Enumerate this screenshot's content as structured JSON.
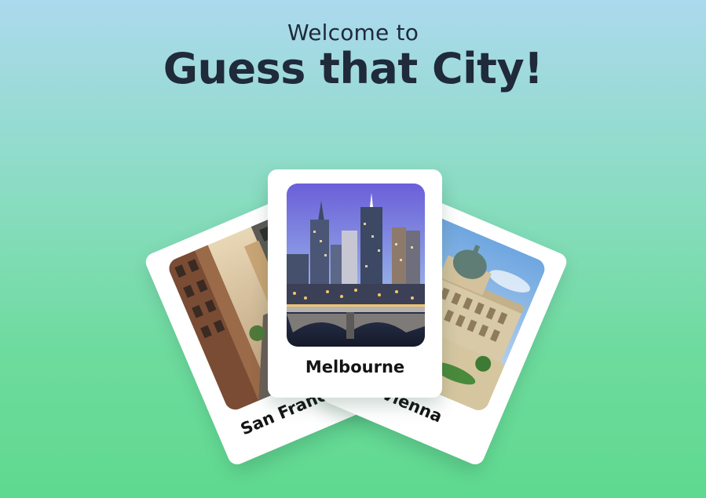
{
  "header": {
    "welcome": "Welcome to",
    "title": "Guess that City!"
  },
  "cards": [
    {
      "city": "San Francisco",
      "photo": "san-francisco-cable-car-street-photo"
    },
    {
      "city": "Vienna",
      "photo": "vienna-museum-palace-photo"
    },
    {
      "city": "Melbourne",
      "photo": "melbourne-skyline-bridge-photo"
    }
  ],
  "colors": {
    "background_top": "#acd9ee",
    "background_bottom": "#5fd98f",
    "title_text": "#1f2a3a",
    "card_bg": "#ffffff"
  }
}
